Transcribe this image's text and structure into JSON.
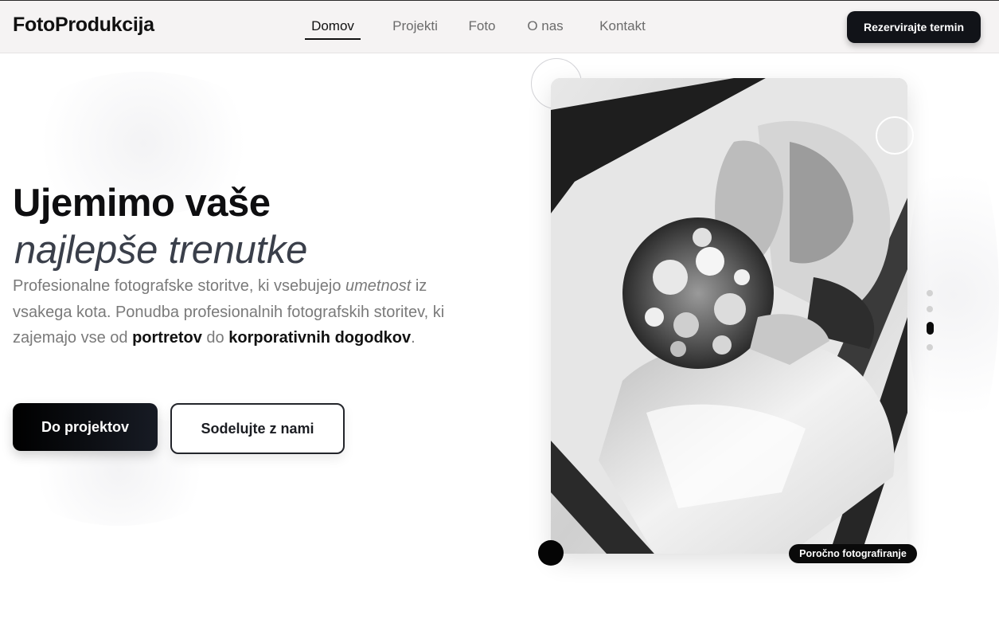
{
  "header": {
    "logo": "FotoProdukcija",
    "nav": [
      {
        "label": "Domov",
        "active": true
      },
      {
        "label": "Projekti",
        "active": false
      },
      {
        "label": "Foto",
        "active": false
      },
      {
        "label": "O nas",
        "active": false
      },
      {
        "label": "Kontakt",
        "active": false
      }
    ],
    "cta_label": "Rezervirajte termin"
  },
  "hero": {
    "title": "Ujemimo vaše",
    "subtitle": "najlepše trenutke",
    "description": {
      "part1": "Profesionalne fotografske storitve, ki vsebujejo ",
      "em": "umetnost",
      "part2": " iz vsakega kota. Ponudba profesionalnih fotografskih storitev, ki zajemajo vse od ",
      "strong1": "portretov",
      "part3": " do ",
      "strong2": "korporativnih dogodkov",
      "part4": "."
    },
    "primary_button": "Do projektov",
    "secondary_button": "Sodelujte z nami"
  },
  "gallery": {
    "image_caption": "Poročno fotografiranje",
    "image_alt": "black-and-white wedding photo of a bride holding a flower bouquet",
    "slides_total": 4,
    "active_slide": 3
  },
  "colors": {
    "accent": "#111318",
    "header_bg": "#f5f3f3",
    "muted_text": "#7a7a7a"
  }
}
